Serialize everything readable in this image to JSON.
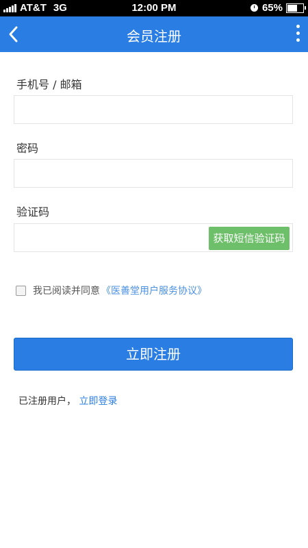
{
  "status_bar": {
    "carrier": "AT&T",
    "network": "3G",
    "time": "12:00 PM",
    "battery_percent": "65%",
    "battery_level": 0.65,
    "icons": [
      "signal-icon",
      "alarm-clock-icon",
      "battery-icon"
    ]
  },
  "nav": {
    "title": "会员注册",
    "back_icon": "chevron-left-icon",
    "more_icon": "more-vertical-icon"
  },
  "form": {
    "phone_label": "手机号 / 邮箱",
    "phone_value": "",
    "password_label": "密码",
    "password_value": "",
    "code_label": "验证码",
    "code_value": "",
    "sms_button": "获取短信验证码"
  },
  "agreement": {
    "checked": false,
    "text": "我已阅读并同意",
    "link": "《医善堂用户服务协议》"
  },
  "submit_label": "立即注册",
  "footer": {
    "text": "已注册用户，",
    "link": "立即登录"
  },
  "colors": {
    "primary": "#2a7ee3",
    "sms_button": "#6dbf6a",
    "link": "#4a90e2"
  }
}
